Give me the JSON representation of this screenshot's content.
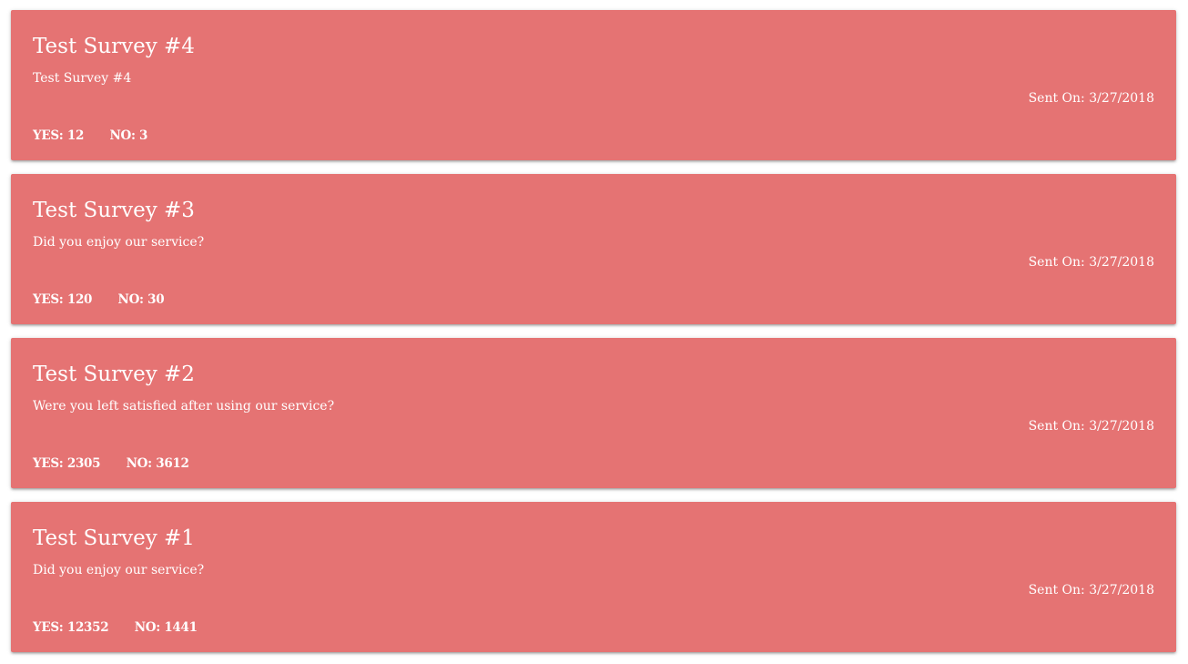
{
  "surveys": [
    {
      "title": "Test Survey #4",
      "body": "Test Survey #4",
      "sent": "Sent On: 3/27/2018",
      "yes": "YES: 12",
      "no": "NO: 3"
    },
    {
      "title": "Test Survey #3",
      "body": "Did you enjoy our service?",
      "sent": "Sent On: 3/27/2018",
      "yes": "YES: 120",
      "no": "NO: 30"
    },
    {
      "title": "Test Survey #2",
      "body": "Were you left satisfied after using our service?",
      "sent": "Sent On: 3/27/2018",
      "yes": "YES: 2305",
      "no": "NO: 3612"
    },
    {
      "title": "Test Survey #1",
      "body": "Did you enjoy our service?",
      "sent": "Sent On: 3/27/2018",
      "yes": "YES: 12352",
      "no": "NO: 1441"
    }
  ],
  "colors": {
    "card_background": "#e57373",
    "text": "#ffffff",
    "page_background": "#ffffff"
  }
}
